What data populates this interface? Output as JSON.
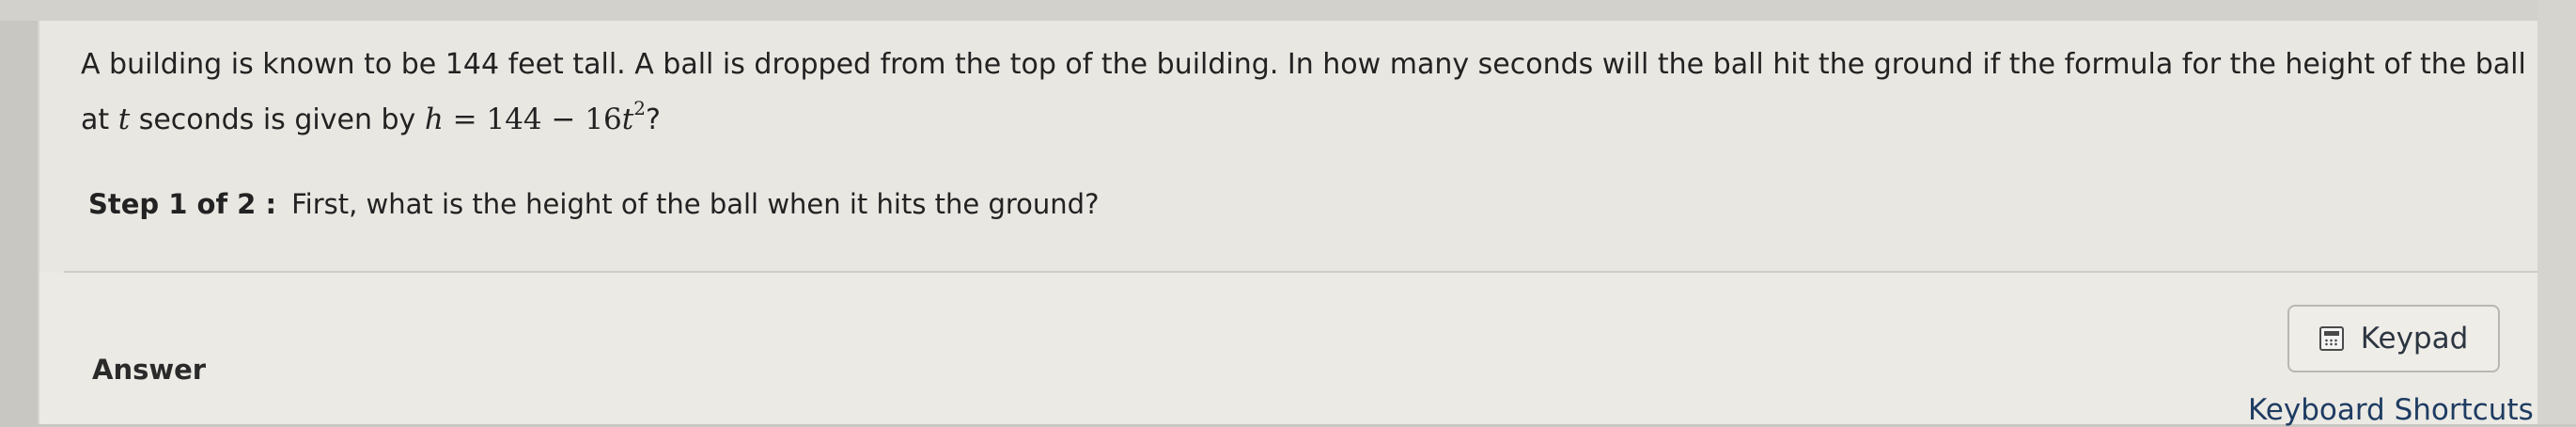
{
  "question": {
    "text_part1": "A building is known to be 144 feet tall. A ball is dropped from the top of the building. In how many seconds will the ball hit the ground if the formula for the height of the ball at ",
    "variable_t": "t",
    "text_part2": " seconds is given by ",
    "formula_lhs": "h",
    "formula_rhs_prefix": " = 144 − 16",
    "formula_var": "t",
    "formula_exp": "2",
    "text_part3": "?"
  },
  "step": {
    "label": "Step 1 of 2 :",
    "prompt": "First, what is the height of the ball when it hits the ground?"
  },
  "answer": {
    "label": "Answer"
  },
  "controls": {
    "keypad_label": "Keypad",
    "keypad_icon": "calculator-icon",
    "shortcuts_label": "Keyboard Shortcuts"
  }
}
